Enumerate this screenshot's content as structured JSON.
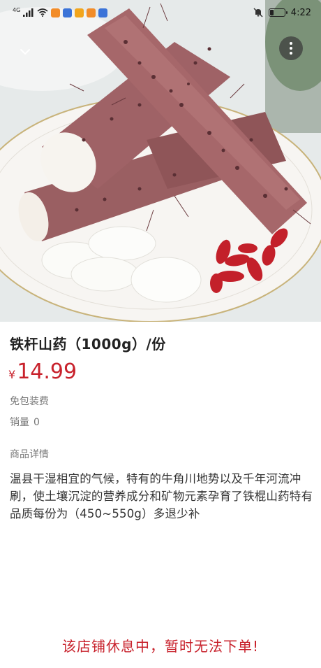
{
  "status_bar": {
    "network": "4G",
    "time": "4:22",
    "colors": {
      "app1": "#f28c28",
      "app2": "#3a73d8",
      "app3": "#f2a51c",
      "app4": "#3a73d8"
    }
  },
  "product": {
    "title": "铁杆山药（1000g）/份",
    "currency": "¥",
    "price": "14.99",
    "shipping": "免包装费",
    "sales_label": "销量",
    "sales_count": "0",
    "details_label": "商品详情",
    "description": "温县干湿相宜的气候，特有的牛角川地势以及千年河流冲刷，使土壤沉淀的营养成分和矿物元素孕育了铁棍山药特有品质每份为（450~550g）多退少补"
  },
  "notice": "该店铺休息中，暂时无法下单!",
  "icons": {
    "back": "chevron-down-icon",
    "more": "more-vertical-icon",
    "mute": "bell-off-icon",
    "wifi": "wifi-icon",
    "signal": "signal-icon",
    "battery": "battery-icon"
  },
  "theme": {
    "accent": "#c8222c",
    "muted": "#777777"
  }
}
